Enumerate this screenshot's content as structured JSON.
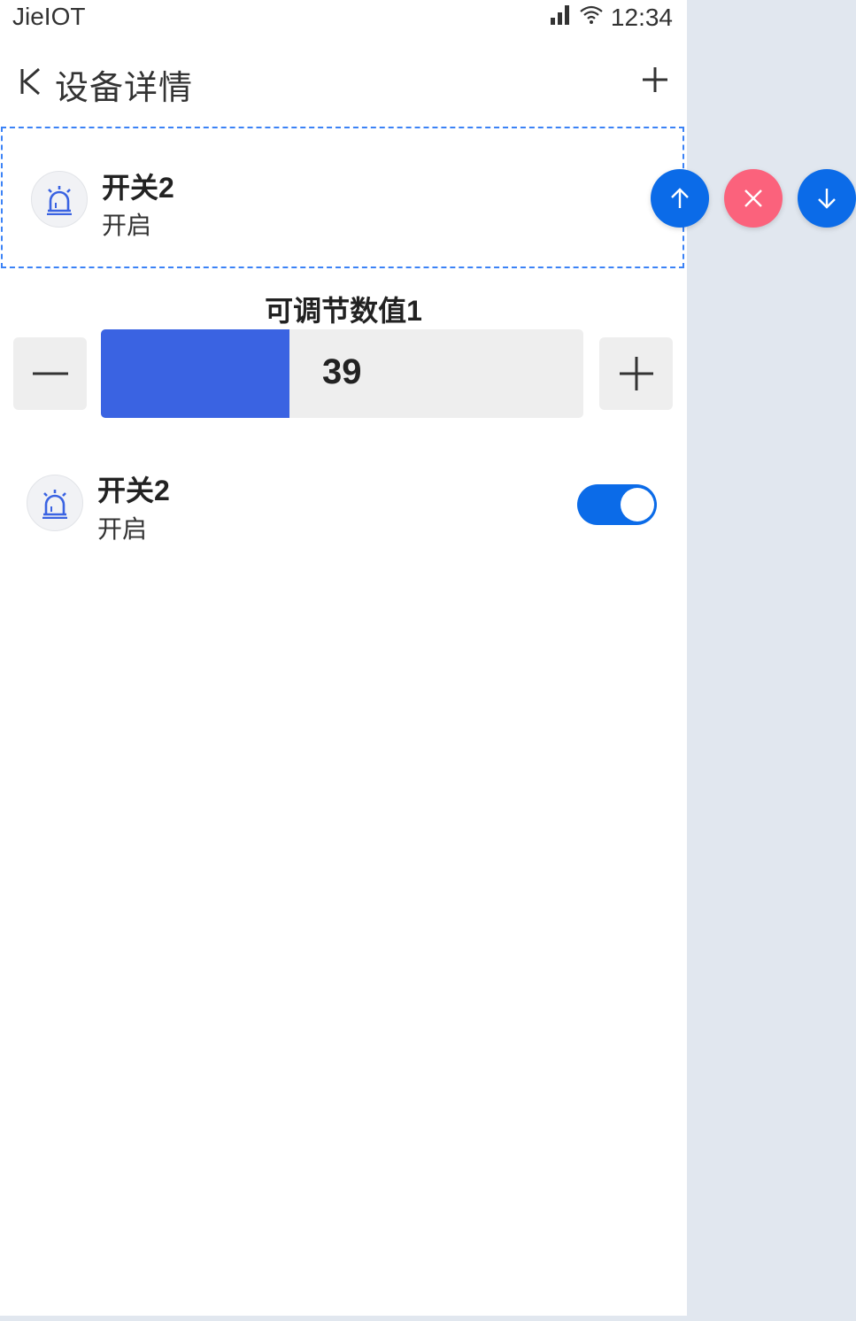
{
  "statusbar": {
    "carrier": "JieIOT",
    "time": "12:34"
  },
  "navbar": {
    "title": "设备详情"
  },
  "selected_card": {
    "name": "开关2",
    "state": "开启"
  },
  "slider": {
    "label": "可调节数值1",
    "value": "39",
    "fill_percent": 39
  },
  "switch_card": {
    "name": "开关2",
    "state": "开启",
    "on": true
  },
  "colors": {
    "accent": "#0b6be8",
    "delete": "#fb627c",
    "slider_fill": "#3a63e2"
  }
}
